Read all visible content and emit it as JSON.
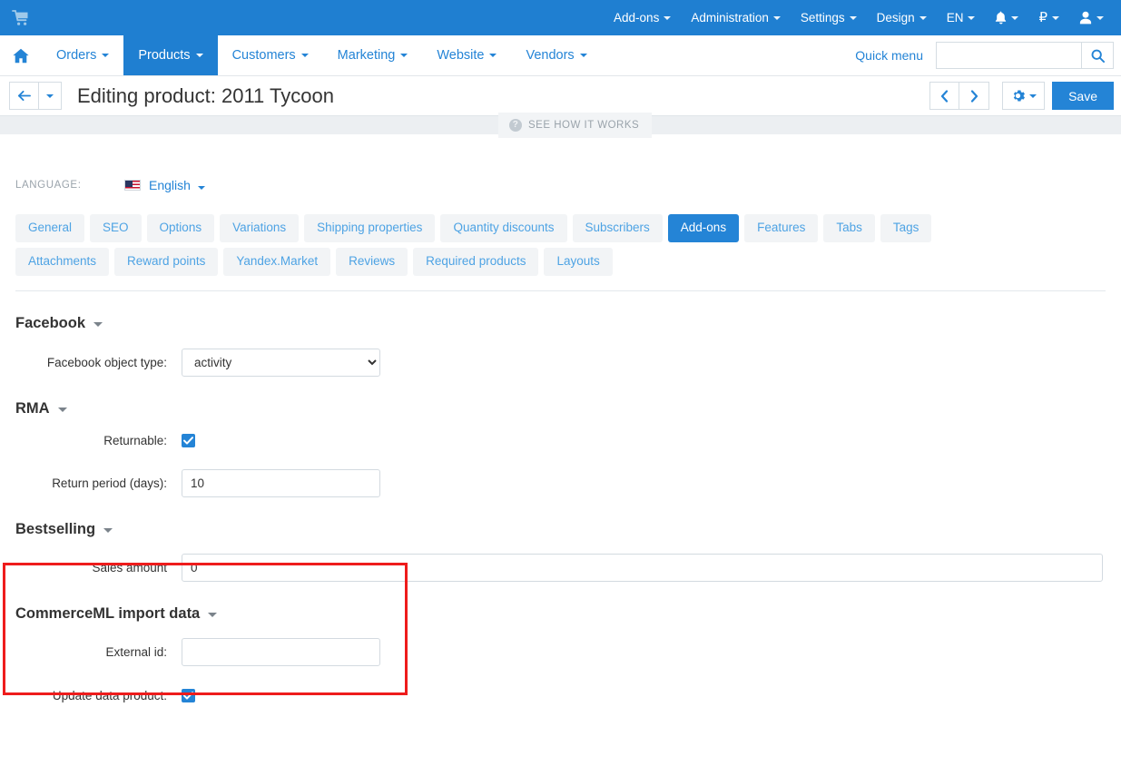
{
  "topbar": {
    "logo_icon": "shopping-cart-icon",
    "menu": [
      {
        "label": "Add-ons",
        "icon": null
      },
      {
        "label": "Administration",
        "icon": null
      },
      {
        "label": "Settings",
        "icon": null
      },
      {
        "label": "Design",
        "icon": null
      },
      {
        "label": "EN",
        "icon": null
      }
    ],
    "notifications_icon": "bell-icon",
    "currency_icon": "ruble-icon",
    "currency_symbol": "₽",
    "account_icon": "user-icon"
  },
  "nav": {
    "home_icon": "home-icon",
    "items": [
      {
        "label": "Orders",
        "active": false
      },
      {
        "label": "Products",
        "active": true
      },
      {
        "label": "Customers",
        "active": false
      },
      {
        "label": "Marketing",
        "active": false
      },
      {
        "label": "Website",
        "active": false
      },
      {
        "label": "Vendors",
        "active": false
      }
    ],
    "quick_menu": "Quick menu",
    "search": {
      "value": "",
      "placeholder": "",
      "icon": "search-icon"
    }
  },
  "titlebar": {
    "back_icon": "arrow-left-icon",
    "back_dropdown_icon": "caret-down-icon",
    "title": "Editing product: 2011 Tycoon",
    "prev_icon": "chevron-left-icon",
    "next_icon": "chevron-right-icon",
    "gear_icon": "gear-icon",
    "save_label": "Save"
  },
  "tooltip": {
    "icon": "question-circle-icon",
    "label": "SEE HOW IT WORKS"
  },
  "language": {
    "label": "LANGUAGE:",
    "flag_icon": "us-flag-icon",
    "value": "English",
    "caret_icon": "caret-down-icon"
  },
  "tabs": [
    {
      "label": "General",
      "active": false
    },
    {
      "label": "SEO",
      "active": false
    },
    {
      "label": "Options",
      "active": false
    },
    {
      "label": "Variations",
      "active": false
    },
    {
      "label": "Shipping properties",
      "active": false
    },
    {
      "label": "Quantity discounts",
      "active": false
    },
    {
      "label": "Subscribers",
      "active": false
    },
    {
      "label": "Add-ons",
      "active": true
    },
    {
      "label": "Features",
      "active": false
    },
    {
      "label": "Tabs",
      "active": false
    },
    {
      "label": "Tags",
      "active": false
    },
    {
      "label": "Attachments",
      "active": false
    },
    {
      "label": "Reward points",
      "active": false
    },
    {
      "label": "Yandex.Market",
      "active": false
    },
    {
      "label": "Reviews",
      "active": false
    },
    {
      "label": "Required products",
      "active": false
    },
    {
      "label": "Layouts",
      "active": false
    }
  ],
  "sections": {
    "facebook": {
      "title": "Facebook",
      "object_type_label": "Facebook object type:",
      "object_type_value": "activity"
    },
    "rma": {
      "title": "RMA",
      "returnable_label": "Returnable:",
      "returnable_checked": true,
      "return_period_label": "Return period (days):",
      "return_period_value": "10",
      "highlighted": true
    },
    "bestselling": {
      "title": "Bestselling",
      "sales_amount_label": "Sales amount",
      "sales_amount_value": "0"
    },
    "commerceml": {
      "title": "CommerceML import data",
      "external_id_label": "External id:",
      "external_id_value": "",
      "update_data_label": "Update data product:",
      "update_data_checked": true
    }
  },
  "colors": {
    "header_blue": "#1f7fd1",
    "link_blue": "#2484d6",
    "tab_bg": "#f2f4f6",
    "highlight_red": "#ee1c1c",
    "strip_gray": "#eceff2"
  }
}
